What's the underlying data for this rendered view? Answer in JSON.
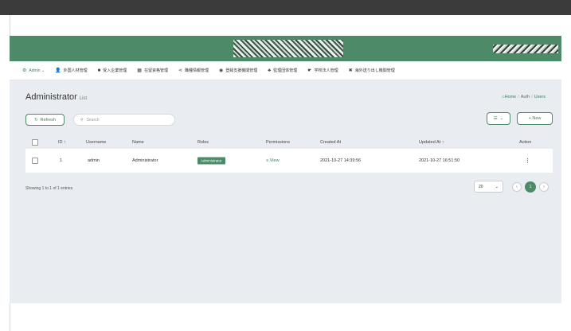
{
  "nav": {
    "admin": {
      "label": "Admin ⌄",
      "icon": "admin-gear-icon"
    },
    "items": [
      {
        "label": "外国人材管理",
        "icon": "person-icon"
      },
      {
        "label": "受入企業管理",
        "icon": "building-icon"
      },
      {
        "label": "在留資格管理",
        "icon": "calendar-icon"
      },
      {
        "label": "職種情報管理",
        "icon": "share-icon"
      },
      {
        "label": "登録支援機関管理",
        "icon": "eye-icon"
      },
      {
        "label": "監理団体管理",
        "icon": "group-icon"
      },
      {
        "label": "学校法人管理",
        "icon": "hand-icon"
      },
      {
        "label": "海外送り出し機関管理",
        "icon": "cross-icon"
      }
    ]
  },
  "page": {
    "title": "Administrator",
    "subtitle": "List",
    "breadcrumb": {
      "home": "Home",
      "auth": "Auth",
      "users": "Users"
    }
  },
  "toolbar": {
    "refresh_label": "Refresh",
    "search_placeholder": "Search",
    "new_label": "+ New"
  },
  "table": {
    "headers": {
      "id": "ID ↑",
      "username": "Username",
      "name": "Name",
      "roles": "Roles",
      "permissions": "Permissions",
      "created_at": "Created At",
      "updated_at": "Updated At ↑",
      "action": "Action"
    },
    "rows": [
      {
        "id": "1",
        "username": "admin",
        "name": "Administrator",
        "role": "Administrator",
        "permissions": "≡ View",
        "created_at": "2021-10-27 14:39:56",
        "updated_at": "2021-10-27 16:51:50",
        "action": "⋮"
      }
    ]
  },
  "footer": {
    "showing": "Showing 1 to 1 of 1 entries",
    "per_page": "20",
    "current_page": "1"
  },
  "colors": {
    "brand": "#4d8a68",
    "content_bg": "#e9edf1",
    "topbar": "#3b3b3b"
  }
}
